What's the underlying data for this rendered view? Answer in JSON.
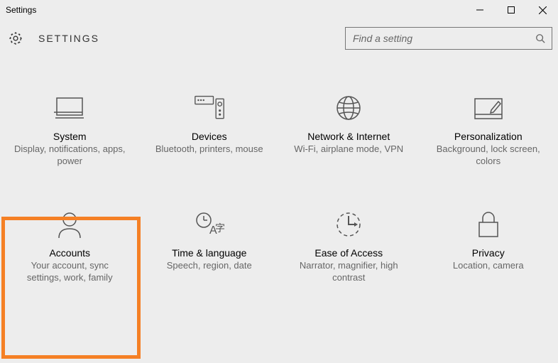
{
  "window": {
    "title": "Settings"
  },
  "header": {
    "title": "SETTINGS"
  },
  "search": {
    "placeholder": "Find a setting"
  },
  "tiles": [
    {
      "title": "System",
      "desc": "Display, notifications, apps, power"
    },
    {
      "title": "Devices",
      "desc": "Bluetooth, printers, mouse"
    },
    {
      "title": "Network & Internet",
      "desc": "Wi-Fi, airplane mode, VPN"
    },
    {
      "title": "Personalization",
      "desc": "Background, lock screen, colors"
    },
    {
      "title": "Accounts",
      "desc": "Your account, sync settings, work, family"
    },
    {
      "title": "Time & language",
      "desc": "Speech, region, date"
    },
    {
      "title": "Ease of Access",
      "desc": "Narrator, magnifier, high contrast"
    },
    {
      "title": "Privacy",
      "desc": "Location, camera"
    }
  ],
  "highlight": {
    "tile_index": 4
  }
}
